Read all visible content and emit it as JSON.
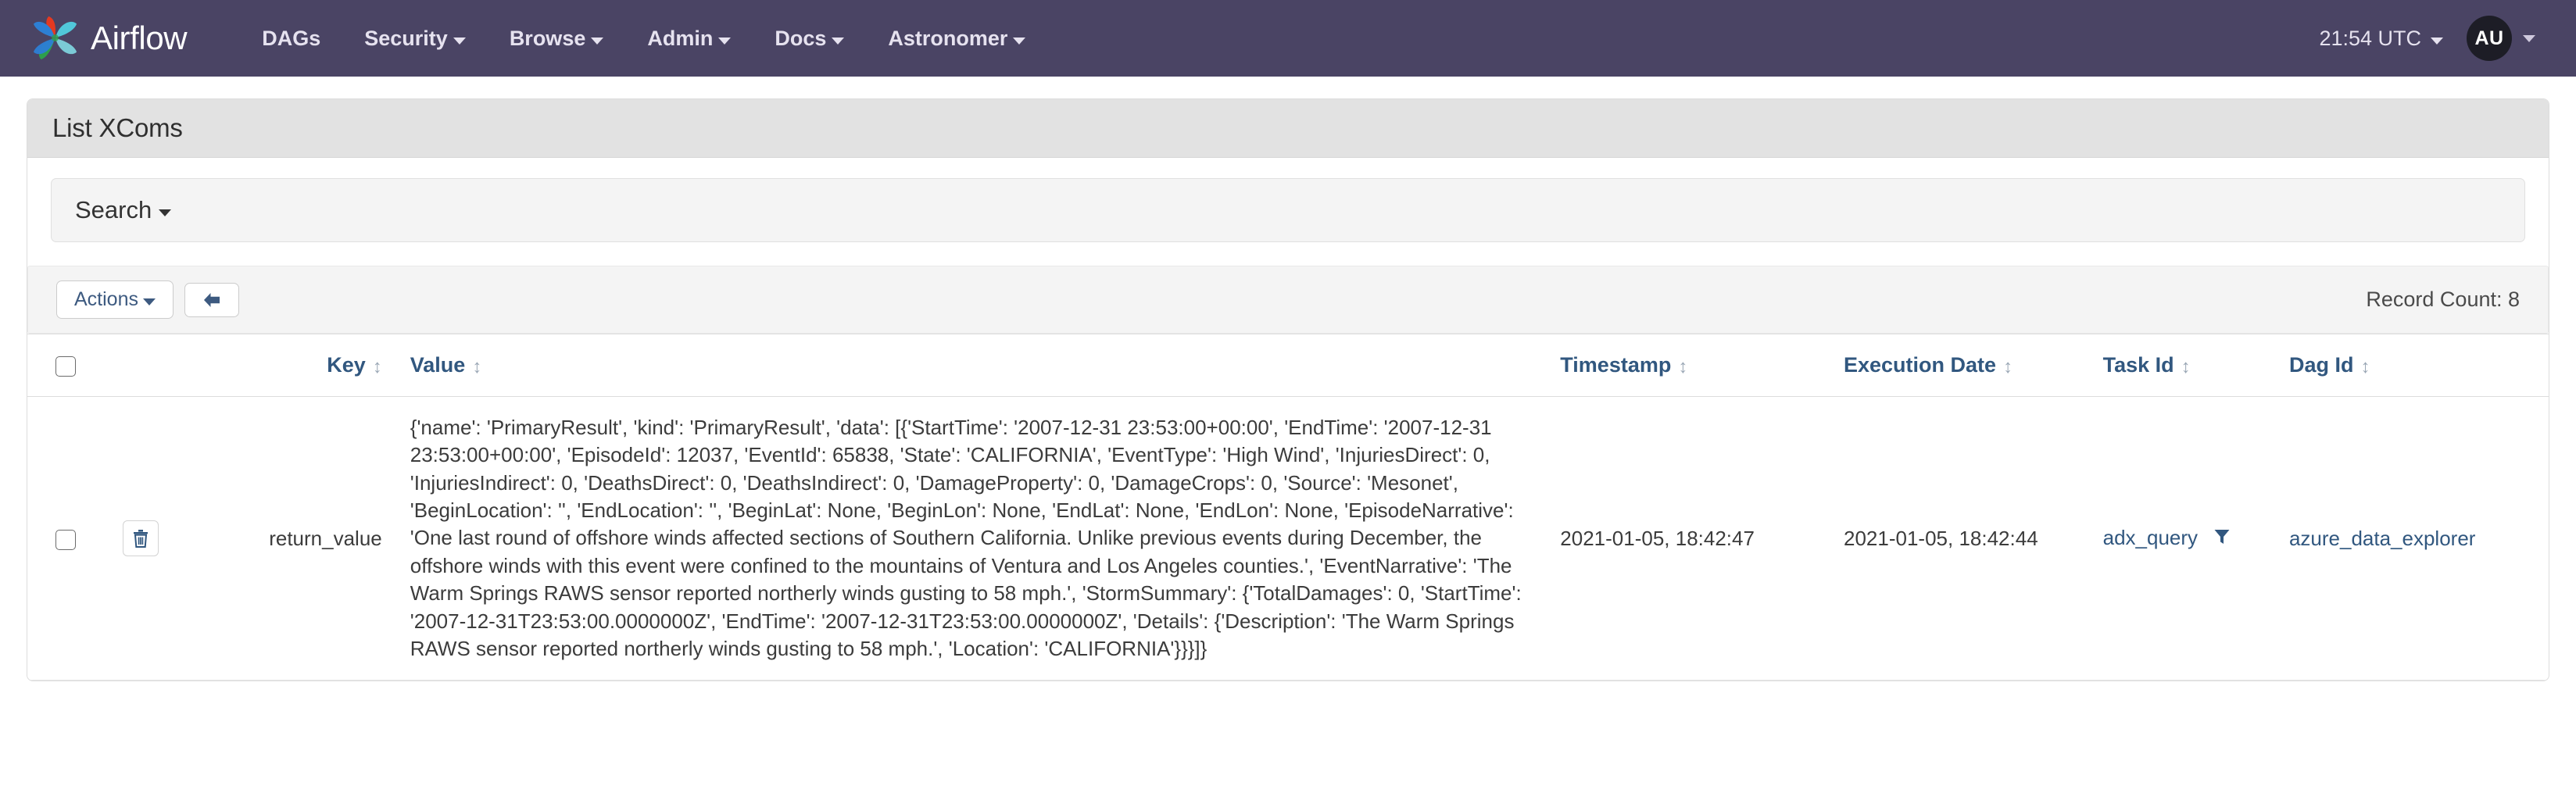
{
  "navbar": {
    "brand": "Airflow",
    "logo_icon": "airflow-pinwheel-logo",
    "links": [
      {
        "label": "DAGs",
        "has_caret": false
      },
      {
        "label": "Security",
        "has_caret": true
      },
      {
        "label": "Browse",
        "has_caret": true
      },
      {
        "label": "Admin",
        "has_caret": true
      },
      {
        "label": "Docs",
        "has_caret": true
      },
      {
        "label": "Astronomer",
        "has_caret": true
      }
    ],
    "clock": "21:54 UTC",
    "clock_caret_icon": "chevron-down-icon",
    "avatar_initials": "AU",
    "avatar_caret_icon": "chevron-down-icon",
    "background_color": "#4a4464"
  },
  "panel": {
    "title": "List XComs"
  },
  "search": {
    "label": "Search",
    "caret_icon": "caret-down-icon"
  },
  "toolbar": {
    "actions_label": "Actions",
    "actions_caret_icon": "caret-down-icon",
    "back_icon": "arrow-left-icon",
    "back_label": "←",
    "record_count_label": "Record Count: 8"
  },
  "table": {
    "select_all_icon": "checkbox-unchecked-icon",
    "sort_icon": "sort-updown-icon",
    "columns": [
      {
        "key": "checkbox",
        "label": ""
      },
      {
        "key": "actions",
        "label": ""
      },
      {
        "key": "key",
        "label": "Key",
        "sortable": true
      },
      {
        "key": "value",
        "label": "Value",
        "sortable": true
      },
      {
        "key": "timestamp",
        "label": "Timestamp",
        "sortable": true
      },
      {
        "key": "execution_date",
        "label": "Execution Date",
        "sortable": true
      },
      {
        "key": "task_id",
        "label": "Task Id",
        "sortable": true
      },
      {
        "key": "dag_id",
        "label": "Dag Id",
        "sortable": true
      }
    ],
    "rows": [
      {
        "checkbox_icon": "checkbox-unchecked-icon",
        "delete_icon": "trash-icon",
        "key": "return_value",
        "value": "{'name': 'PrimaryResult', 'kind': 'PrimaryResult', 'data': [{'StartTime': '2007-12-31 23:53:00+00:00', 'EndTime': '2007-12-31 23:53:00+00:00', 'EpisodeId': 12037, 'EventId': 65838, 'State': 'CALIFORNIA', 'EventType': 'High Wind', 'InjuriesDirect': 0, 'InjuriesIndirect': 0, 'DeathsDirect': 0, 'DeathsIndirect': 0, 'DamageProperty': 0, 'DamageCrops': 0, 'Source': 'Mesonet', 'BeginLocation': '', 'EndLocation': '', 'BeginLat': None, 'BeginLon': None, 'EndLat': None, 'EndLon': None, 'EpisodeNarrative': 'One last round of offshore winds affected sections of Southern California. Unlike previous events during December, the offshore winds with this event were confined to the mountains of Ventura and Los Angeles counties.', 'EventNarrative': 'The Warm Springs RAWS sensor reported northerly winds gusting to 58 mph.', 'StormSummary': {'TotalDamages': 0, 'StartTime': '2007-12-31T23:53:00.0000000Z', 'EndTime': '2007-12-31T23:53:00.0000000Z', 'Details': {'Description': 'The Warm Springs RAWS sensor reported northerly winds gusting to 58 mph.', 'Location': 'CALIFORNIA'}}}]}",
        "timestamp": "2021-01-05, 18:42:47",
        "execution_date": "2021-01-05, 18:42:44",
        "task_id": "adx_query",
        "task_filter_icon": "filter-funnel-icon",
        "dag_id": "azure_data_explorer"
      }
    ]
  },
  "colors": {
    "navbar_bg": "#4a4464",
    "link_blue": "#31577f",
    "panel_head_bg": "#e2e2e2",
    "well_bg": "#f4f4f4"
  }
}
